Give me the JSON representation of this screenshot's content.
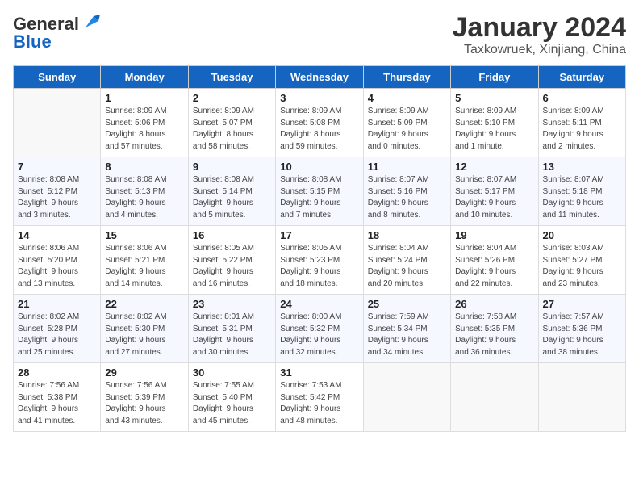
{
  "logo": {
    "text_general": "General",
    "text_blue": "Blue"
  },
  "header": {
    "title": "January 2024",
    "subtitle": "Taxkowruek, Xinjiang, China"
  },
  "days_of_week": [
    "Sunday",
    "Monday",
    "Tuesday",
    "Wednesday",
    "Thursday",
    "Friday",
    "Saturday"
  ],
  "weeks": [
    [
      {
        "num": "",
        "detail": ""
      },
      {
        "num": "1",
        "detail": "Sunrise: 8:09 AM\nSunset: 5:06 PM\nDaylight: 8 hours\nand 57 minutes."
      },
      {
        "num": "2",
        "detail": "Sunrise: 8:09 AM\nSunset: 5:07 PM\nDaylight: 8 hours\nand 58 minutes."
      },
      {
        "num": "3",
        "detail": "Sunrise: 8:09 AM\nSunset: 5:08 PM\nDaylight: 8 hours\nand 59 minutes."
      },
      {
        "num": "4",
        "detail": "Sunrise: 8:09 AM\nSunset: 5:09 PM\nDaylight: 9 hours\nand 0 minutes."
      },
      {
        "num": "5",
        "detail": "Sunrise: 8:09 AM\nSunset: 5:10 PM\nDaylight: 9 hours\nand 1 minute."
      },
      {
        "num": "6",
        "detail": "Sunrise: 8:09 AM\nSunset: 5:11 PM\nDaylight: 9 hours\nand 2 minutes."
      }
    ],
    [
      {
        "num": "7",
        "detail": "Sunrise: 8:08 AM\nSunset: 5:12 PM\nDaylight: 9 hours\nand 3 minutes."
      },
      {
        "num": "8",
        "detail": "Sunrise: 8:08 AM\nSunset: 5:13 PM\nDaylight: 9 hours\nand 4 minutes."
      },
      {
        "num": "9",
        "detail": "Sunrise: 8:08 AM\nSunset: 5:14 PM\nDaylight: 9 hours\nand 5 minutes."
      },
      {
        "num": "10",
        "detail": "Sunrise: 8:08 AM\nSunset: 5:15 PM\nDaylight: 9 hours\nand 7 minutes."
      },
      {
        "num": "11",
        "detail": "Sunrise: 8:07 AM\nSunset: 5:16 PM\nDaylight: 9 hours\nand 8 minutes."
      },
      {
        "num": "12",
        "detail": "Sunrise: 8:07 AM\nSunset: 5:17 PM\nDaylight: 9 hours\nand 10 minutes."
      },
      {
        "num": "13",
        "detail": "Sunrise: 8:07 AM\nSunset: 5:18 PM\nDaylight: 9 hours\nand 11 minutes."
      }
    ],
    [
      {
        "num": "14",
        "detail": "Sunrise: 8:06 AM\nSunset: 5:20 PM\nDaylight: 9 hours\nand 13 minutes."
      },
      {
        "num": "15",
        "detail": "Sunrise: 8:06 AM\nSunset: 5:21 PM\nDaylight: 9 hours\nand 14 minutes."
      },
      {
        "num": "16",
        "detail": "Sunrise: 8:05 AM\nSunset: 5:22 PM\nDaylight: 9 hours\nand 16 minutes."
      },
      {
        "num": "17",
        "detail": "Sunrise: 8:05 AM\nSunset: 5:23 PM\nDaylight: 9 hours\nand 18 minutes."
      },
      {
        "num": "18",
        "detail": "Sunrise: 8:04 AM\nSunset: 5:24 PM\nDaylight: 9 hours\nand 20 minutes."
      },
      {
        "num": "19",
        "detail": "Sunrise: 8:04 AM\nSunset: 5:26 PM\nDaylight: 9 hours\nand 22 minutes."
      },
      {
        "num": "20",
        "detail": "Sunrise: 8:03 AM\nSunset: 5:27 PM\nDaylight: 9 hours\nand 23 minutes."
      }
    ],
    [
      {
        "num": "21",
        "detail": "Sunrise: 8:02 AM\nSunset: 5:28 PM\nDaylight: 9 hours\nand 25 minutes."
      },
      {
        "num": "22",
        "detail": "Sunrise: 8:02 AM\nSunset: 5:30 PM\nDaylight: 9 hours\nand 27 minutes."
      },
      {
        "num": "23",
        "detail": "Sunrise: 8:01 AM\nSunset: 5:31 PM\nDaylight: 9 hours\nand 30 minutes."
      },
      {
        "num": "24",
        "detail": "Sunrise: 8:00 AM\nSunset: 5:32 PM\nDaylight: 9 hours\nand 32 minutes."
      },
      {
        "num": "25",
        "detail": "Sunrise: 7:59 AM\nSunset: 5:34 PM\nDaylight: 9 hours\nand 34 minutes."
      },
      {
        "num": "26",
        "detail": "Sunrise: 7:58 AM\nSunset: 5:35 PM\nDaylight: 9 hours\nand 36 minutes."
      },
      {
        "num": "27",
        "detail": "Sunrise: 7:57 AM\nSunset: 5:36 PM\nDaylight: 9 hours\nand 38 minutes."
      }
    ],
    [
      {
        "num": "28",
        "detail": "Sunrise: 7:56 AM\nSunset: 5:38 PM\nDaylight: 9 hours\nand 41 minutes."
      },
      {
        "num": "29",
        "detail": "Sunrise: 7:56 AM\nSunset: 5:39 PM\nDaylight: 9 hours\nand 43 minutes."
      },
      {
        "num": "30",
        "detail": "Sunrise: 7:55 AM\nSunset: 5:40 PM\nDaylight: 9 hours\nand 45 minutes."
      },
      {
        "num": "31",
        "detail": "Sunrise: 7:53 AM\nSunset: 5:42 PM\nDaylight: 9 hours\nand 48 minutes."
      },
      {
        "num": "",
        "detail": ""
      },
      {
        "num": "",
        "detail": ""
      },
      {
        "num": "",
        "detail": ""
      }
    ]
  ]
}
